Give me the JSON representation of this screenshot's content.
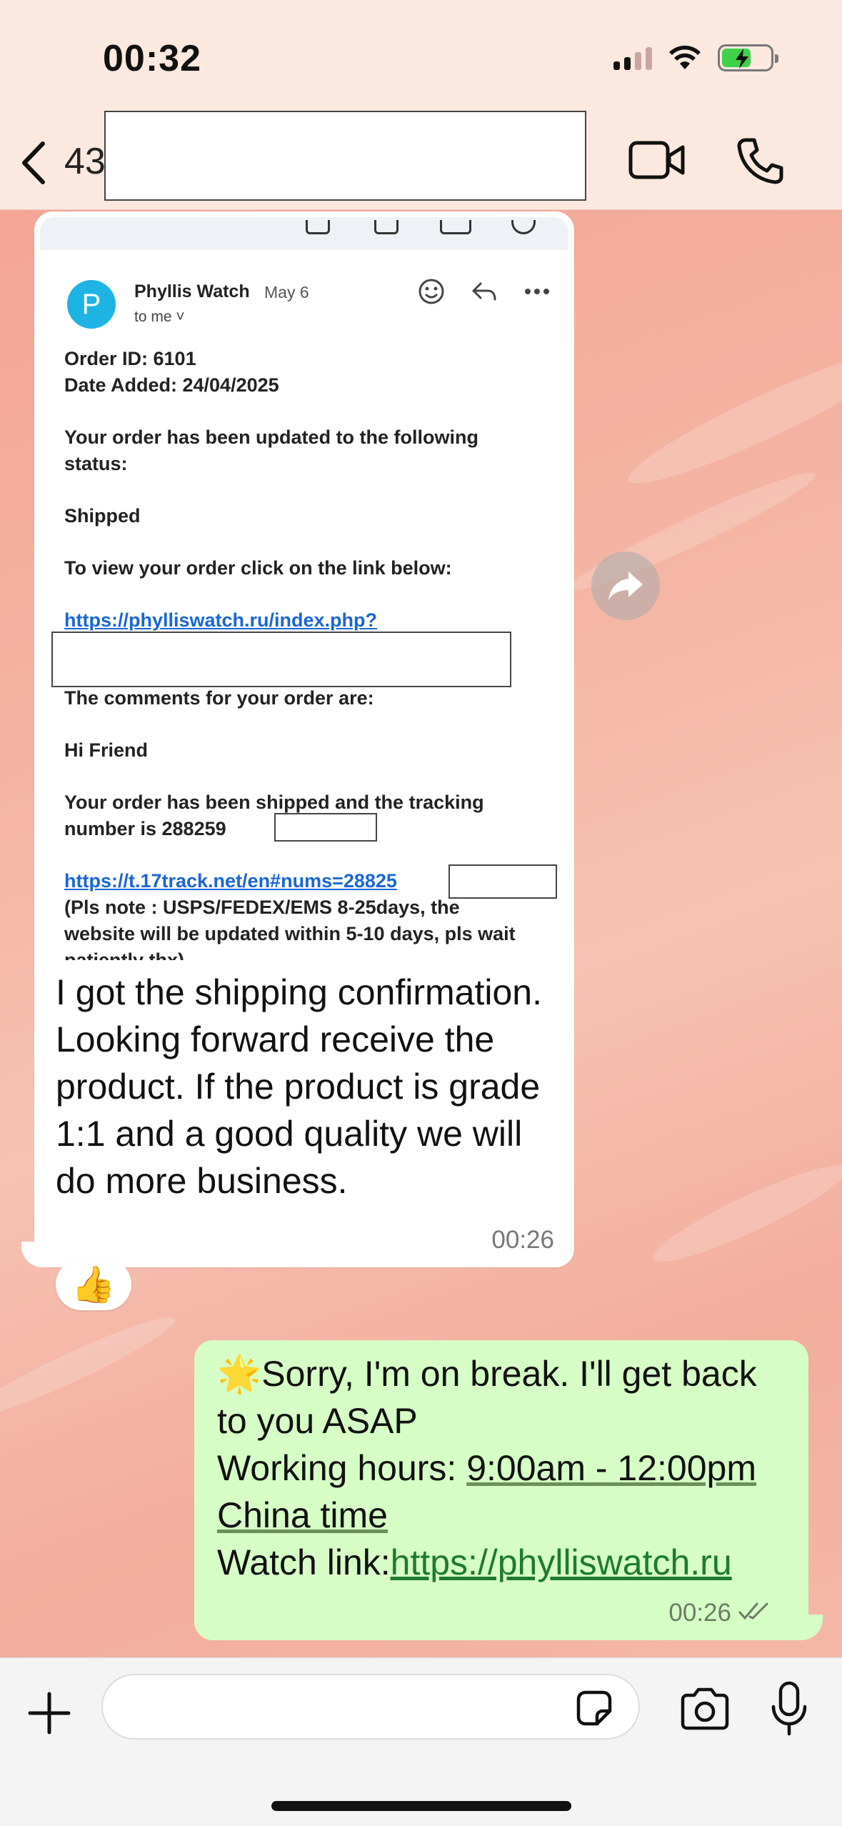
{
  "status_bar": {
    "time": "00:32"
  },
  "header": {
    "contact_partial": "43"
  },
  "email": {
    "avatar_letter": "P",
    "sender": "Phyllis Watch",
    "date": "May 6",
    "recipient": "to me ˅",
    "lines": {
      "order_id": "Order ID: 6101",
      "date_added": "Date Added: 24/04/2025",
      "update_1": "Your order has been updated to the following",
      "update_2": "status:",
      "status": "Shipped",
      "view_prompt": "To view your order click on the link below:",
      "order_link": "https://phylliswatch.ru/index.php?",
      "comments": "The comments for your order are:",
      "greeting": "Hi Friend",
      "shipped_1": "Your order has been shipped and the tracking",
      "shipped_2": "number is 288259",
      "track_link": "https://t.17track.net/en#nums=28825",
      "note_1": "(Pls note : USPS/FEDEX/EMS 8-25days, the",
      "note_2": "website will be updated within 5-10 days, pls wait",
      "note_3": "patiently thx)"
    }
  },
  "incoming": {
    "text": "I got the shipping confirmation. Looking forward receive the product. If the product is grade 1:1 and a good quality we will do more business.",
    "time": "00:26",
    "reaction": "👍"
  },
  "outgoing": {
    "emoji": "🌟",
    "line1": "Sorry, I'm on break. I'll get back to you ASAP",
    "hours_label": "Working hours: ",
    "hours_value": "9:00am - 12:00pm",
    "china_time": "China time",
    "watch_label": "Watch link:",
    "watch_link": "https://phylliswatch.ru",
    "time": "00:26",
    "ticks": "✓✓"
  },
  "colors": {
    "accent_green": "#d6fdc5",
    "link_blue": "#1a66d6",
    "avatar": "#1db4e3"
  }
}
